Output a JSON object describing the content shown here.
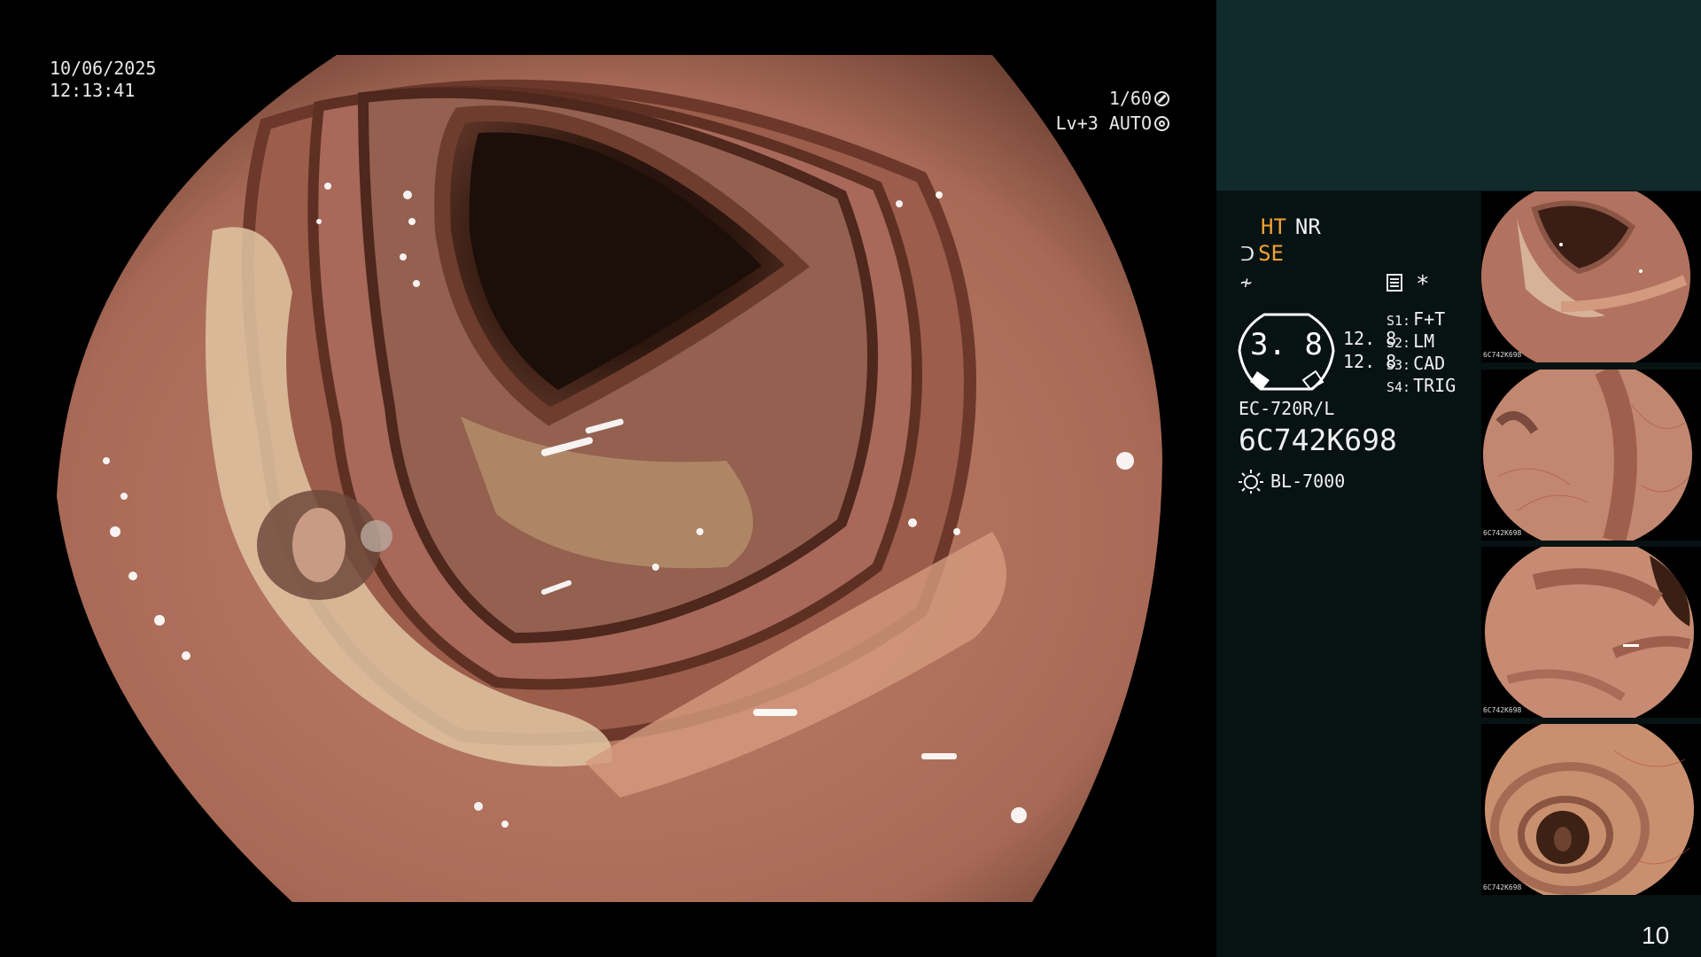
{
  "main_view": {
    "date": "10/06/2025",
    "time": "12:13:41",
    "shutter": "1/60",
    "shutter_icon": "shutter-icon",
    "level": "Lv+3 AUTO",
    "level_icon": "auto-iris-icon"
  },
  "info_panel": {
    "mode_ht": "HT",
    "mode_nr": "NR",
    "structure_enhance": "SE",
    "structure_icon": "structure-enhance-icon",
    "function_icon": "function-icon",
    "memory_icon": "memory-card-icon",
    "asterisk": "*",
    "dial_value": "3. 8",
    "dial_value_a": "12. 8",
    "dial_value_b": "12. 8",
    "switches": [
      {
        "key": "S1:",
        "value": "F+T"
      },
      {
        "key": "S2:",
        "value": "LM"
      },
      {
        "key": "S3:",
        "value": "CAD"
      },
      {
        "key": "S4:",
        "value": "TRIG"
      }
    ],
    "scope_model": "EC-720R/L",
    "serial": "6C742K698",
    "light_source": "BL-7000",
    "light_icon": "light-source-icon",
    "colors": {
      "orange": "#f2a332",
      "panel_top": "#112a2b",
      "panel": "#071213"
    }
  },
  "thumbnails": [
    {
      "serial": "6C742K698"
    },
    {
      "serial": "6C742K698"
    },
    {
      "serial": "6C742K698"
    },
    {
      "serial": "6C742K698"
    }
  ],
  "page_number": "10"
}
